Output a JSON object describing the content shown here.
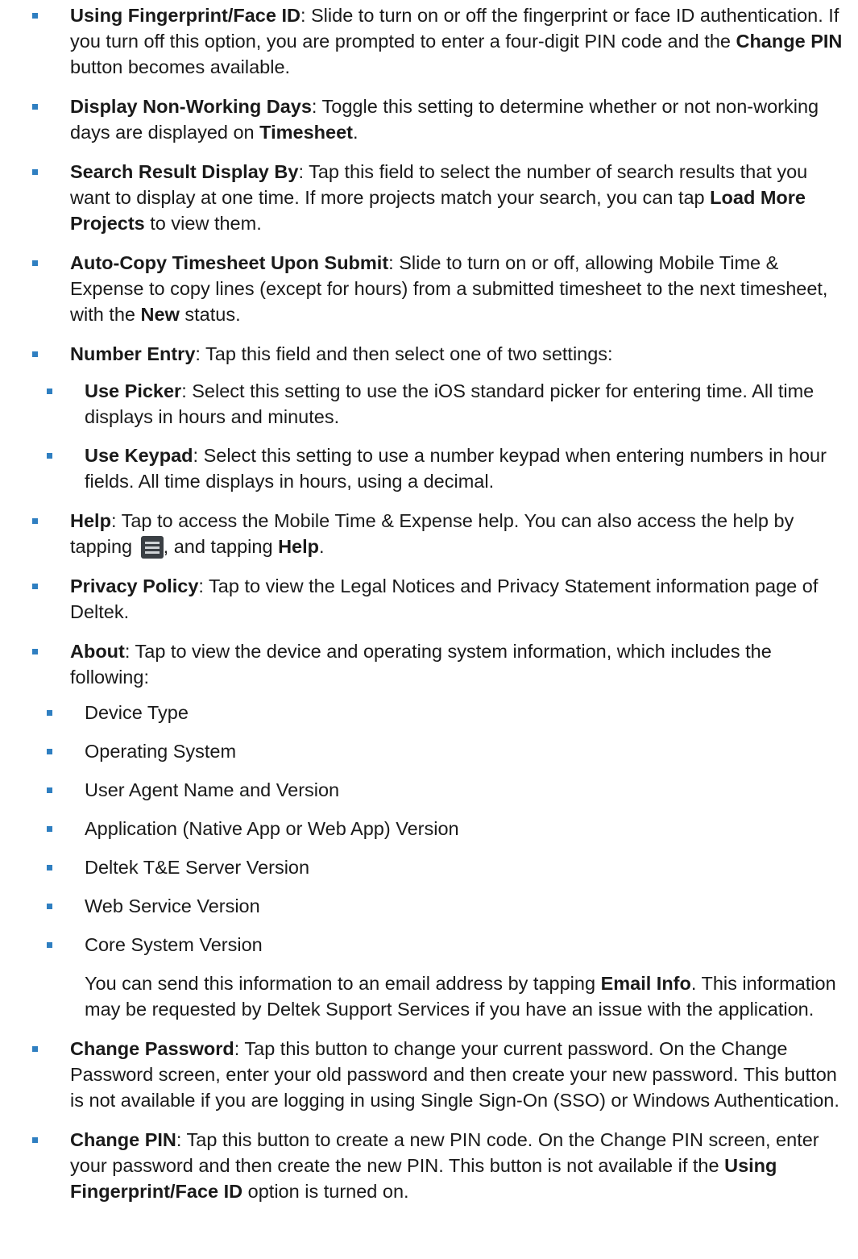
{
  "items": [
    {
      "term": "Using Fingerprint/Face ID",
      "text_a": ": Slide to turn on or off the fingerprint or face ID authentication. If you turn off this option, you are prompted to enter a four-digit PIN code and the ",
      "bold_b": "Change PIN",
      "text_c": " button becomes available."
    },
    {
      "term": "Display Non-Working Days",
      "text_a": ": Toggle this setting to determine whether or not non-working days are displayed on ",
      "bold_b": "Timesheet",
      "text_c": "."
    },
    {
      "term": "Search Result Display By",
      "text_a": ": Tap this field to select the number of search results that you want to display at one time. If more projects match your search, you can tap ",
      "bold_b": "Load More Projects",
      "text_c": " to view them."
    },
    {
      "term": "Auto-Copy Timesheet Upon Submit",
      "text_a": ": Slide to turn on or off, allowing Mobile Time & Expense to copy lines (except for hours) from a submitted timesheet to the next timesheet, with the ",
      "bold_b": "New",
      "text_c": " status."
    },
    {
      "term": "Number Entry",
      "text_a": ": Tap this field and then select one of two settings:",
      "sub": [
        {
          "term": "Use Picker",
          "text": ": Select this setting to use the iOS standard picker for entering time. All time displays in hours and minutes."
        },
        {
          "term": "Use Keypad",
          "text": ": Select this setting to use a number keypad when entering numbers in hour fields. All time displays in hours, using a decimal."
        }
      ]
    },
    {
      "term": "Help",
      "text_a": ": Tap to access the Mobile Time & Expense help. You can also access the help by tapping ",
      "text_b": ", and tapping ",
      "bold_c": "Help",
      "text_d": ".",
      "icon": "menu-icon"
    },
    {
      "term": "Privacy Policy",
      "text_a": ": Tap to view the Legal Notices and Privacy Statement information page of Deltek."
    },
    {
      "term": "About",
      "text_a": ": Tap to view the device and operating system information, which includes the following:",
      "list": [
        "Device Type",
        "Operating System",
        "User Agent Name and Version",
        "Application (Native App or Web App) Version",
        "Deltek T&E Server Version",
        "Web Service Version",
        "Core System Version"
      ],
      "para_a": "You can send this information to an email address by tapping ",
      "para_bold": "Email Info",
      "para_c": ". This information may be requested by Deltek Support Services if you have an issue with the application."
    },
    {
      "term": "Change Password",
      "text_a": ": Tap this button to change your current password. On the Change Password screen, enter your old password and then create your new password. This button is not available if you are logging in using Single Sign-On (SSO) or Windows Authentication."
    },
    {
      "term": "Change PIN",
      "text_a": ": Tap this button to create a new PIN code. On the Change PIN screen, enter your password and then create the new PIN. This button is not available if the ",
      "bold_b": "Using Fingerprint/Face ID",
      "text_c": " option is turned on."
    }
  ]
}
